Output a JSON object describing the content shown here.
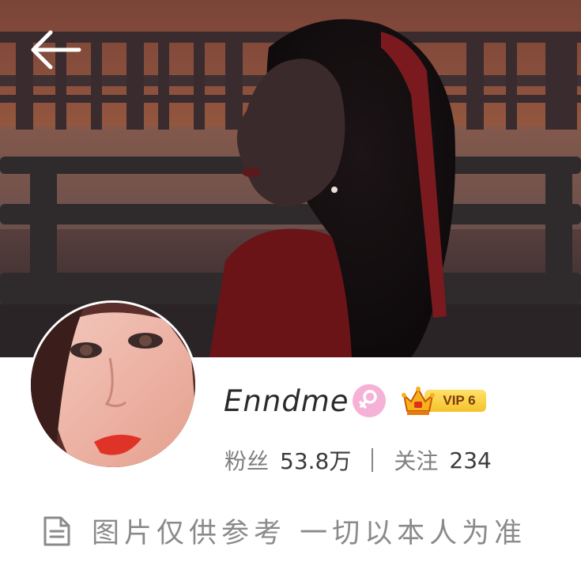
{
  "header": {
    "back_icon": "arrow-left-icon"
  },
  "profile": {
    "username": "Enndme",
    "gender_icon": "female-icon",
    "vip_crown_icon": "crown-icon",
    "vip_label": "VIP 6",
    "followers_label": "粉丝",
    "followers_value": "53.8万",
    "following_label": "关注",
    "following_value": "234"
  },
  "notice": {
    "icon": "document-icon",
    "text": "图片仅供参考 一切以本人为准"
  },
  "colors": {
    "gender_badge": "#f6b2d6",
    "vip_gold": "#f6c22a",
    "text_primary": "#2b2b2b",
    "text_secondary": "#8a8a8a"
  }
}
